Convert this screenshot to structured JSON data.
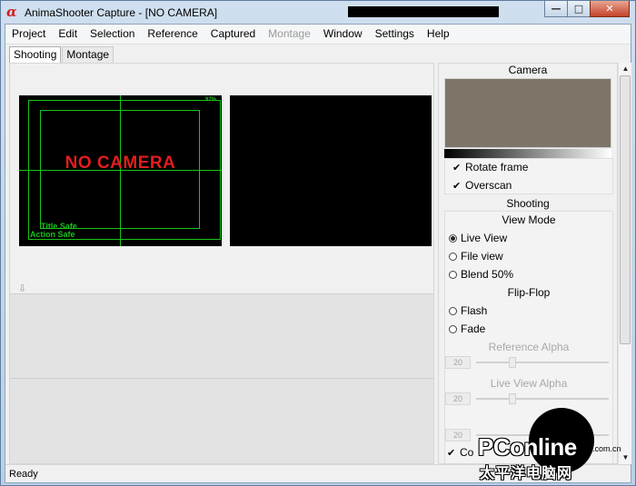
{
  "window": {
    "title": "AnimaShooter Capture - [NO  CAMERA]",
    "logo_glyph": "α",
    "minimize_glyph": "—",
    "maximize_glyph": "□",
    "close_glyph": "✕"
  },
  "menu": [
    {
      "label": "Project",
      "enabled": true
    },
    {
      "label": "Edit",
      "enabled": true
    },
    {
      "label": "Selection",
      "enabled": true
    },
    {
      "label": "Reference",
      "enabled": true
    },
    {
      "label": "Captured",
      "enabled": true
    },
    {
      "label": "Montage",
      "enabled": false
    },
    {
      "label": "Window",
      "enabled": true
    },
    {
      "label": "Settings",
      "enabled": true
    },
    {
      "label": "Help",
      "enabled": true
    }
  ],
  "tabs": {
    "shooting": "Shooting",
    "montage": "Montage",
    "active": "shooting"
  },
  "viewer": {
    "no_camera": "NO  CAMERA",
    "title_safe": "Title Safe",
    "action_safe": "Action Safe",
    "battery": "97%",
    "collapse_glyph": "⇩"
  },
  "camera_panel": {
    "title": "Camera",
    "swatch_color": "#7d7568",
    "rotate_frame": {
      "label": "Rotate frame",
      "checked": true
    },
    "overscan": {
      "label": "Overscan",
      "checked": true
    }
  },
  "shooting_panel": {
    "title": "Shooting",
    "view_mode_title": "View Mode",
    "live_view": {
      "label": "Live View",
      "selected": true
    },
    "file_view": {
      "label": "File view",
      "selected": false
    },
    "blend": {
      "label": "Blend 50%",
      "selected": false
    },
    "flip_flop_title": "Flip-Flop",
    "flash": {
      "label": "Flash",
      "selected": false
    },
    "fade": {
      "label": "Fade",
      "selected": false
    },
    "reference_alpha_label": "Reference Alpha",
    "reference_alpha_value": "20",
    "live_view_alpha_label": "Live View Alpha",
    "live_view_alpha_value": "20",
    "third_slider_value": "20",
    "partial_check_label": "Co"
  },
  "watermark": {
    "brand": "PConline",
    "domain": ".com.cn",
    "subtitle": "太平洋电脑网"
  },
  "status": {
    "text": "Ready"
  },
  "colors": {
    "accent_red": "#e21d1d",
    "overlay_green": "#19c419"
  }
}
